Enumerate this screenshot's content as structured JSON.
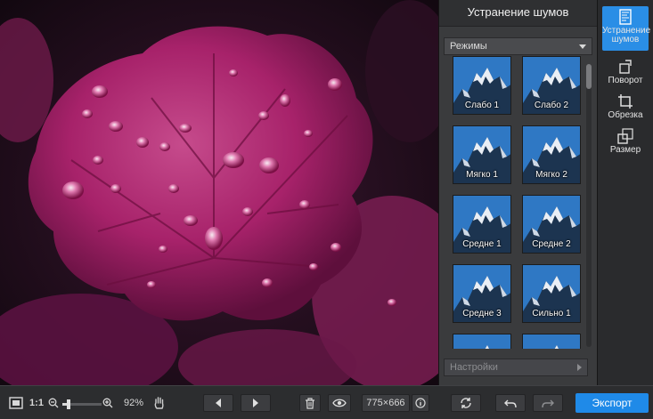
{
  "panel": {
    "title": "Устранение шумов",
    "modes_label": "Режимы",
    "settings_label": "Настройки"
  },
  "presets": [
    {
      "label": "Слабо 1"
    },
    {
      "label": "Слабо 2"
    },
    {
      "label": "Мягко 1"
    },
    {
      "label": "Мягко 2"
    },
    {
      "label": "Средне 1"
    },
    {
      "label": "Средне 2"
    },
    {
      "label": "Средне 3"
    },
    {
      "label": "Сильно 1"
    },
    {
      "label": ""
    },
    {
      "label": ""
    }
  ],
  "tools": [
    {
      "label": "Устранение шумов",
      "icon": "denoise-icon",
      "active": true
    },
    {
      "label": "Поворот",
      "icon": "rotate-icon",
      "active": false
    },
    {
      "label": "Обрезка",
      "icon": "crop-icon",
      "active": false
    },
    {
      "label": "Размер",
      "icon": "resize-icon",
      "active": false
    }
  ],
  "toolbar": {
    "actual_size_label": "1:1",
    "zoom_value": "92%",
    "zoom_slider_level": 0.15,
    "image_size": "775×666",
    "export_label": "Экспорт"
  },
  "colors": {
    "accent": "#2a8ee6",
    "panel_bg": "#3a3b3d",
    "toolbar_bg": "#2c2d2f",
    "leaf": "#b0236f"
  }
}
